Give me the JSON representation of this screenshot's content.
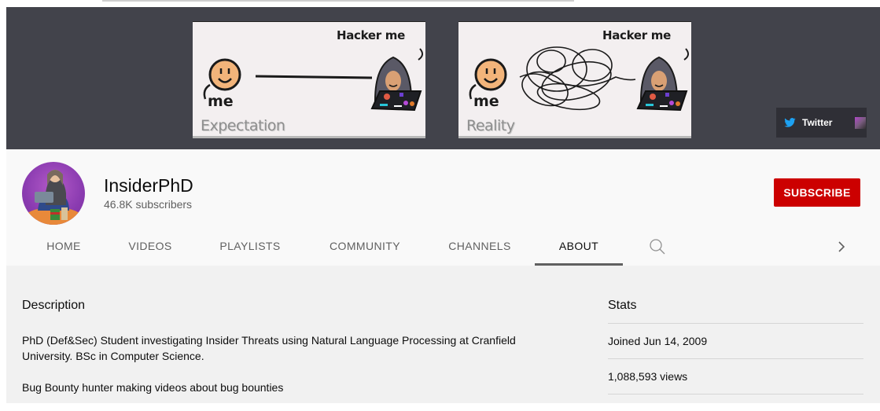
{
  "banner": {
    "panels": [
      {
        "label": "Expectation",
        "hacker_label": "Hacker me",
        "me_label": "me",
        "path": "straight"
      },
      {
        "label": "Reality",
        "hacker_label": "Hacker me",
        "me_label": "me",
        "path": "tangled"
      }
    ],
    "links": [
      {
        "label": "Twitter",
        "icon": "twitter-icon"
      }
    ]
  },
  "channel": {
    "name": "InsiderPhD",
    "subscribers": "46.8K subscribers",
    "subscribe_label": "SUBSCRIBE",
    "accent_color": "#cc0000"
  },
  "tabs": [
    {
      "label": "HOME",
      "active": false
    },
    {
      "label": "VIDEOS",
      "active": false
    },
    {
      "label": "PLAYLISTS",
      "active": false
    },
    {
      "label": "COMMUNITY",
      "active": false
    },
    {
      "label": "CHANNELS",
      "active": false
    },
    {
      "label": "ABOUT",
      "active": true
    }
  ],
  "tab_icons": {
    "search": "search-icon",
    "next": "chevron-right-icon"
  },
  "about": {
    "description_title": "Description",
    "description": [
      "PhD (Def&Sec) Student investigating Insider Threats using Natural Language Processing at Cranfield University. BSc in Computer Science.",
      "Bug Bounty hunter making videos about bug bounties"
    ],
    "stats_title": "Stats",
    "stats": [
      "Joined Jun 14, 2009",
      "1,088,593 views"
    ]
  }
}
